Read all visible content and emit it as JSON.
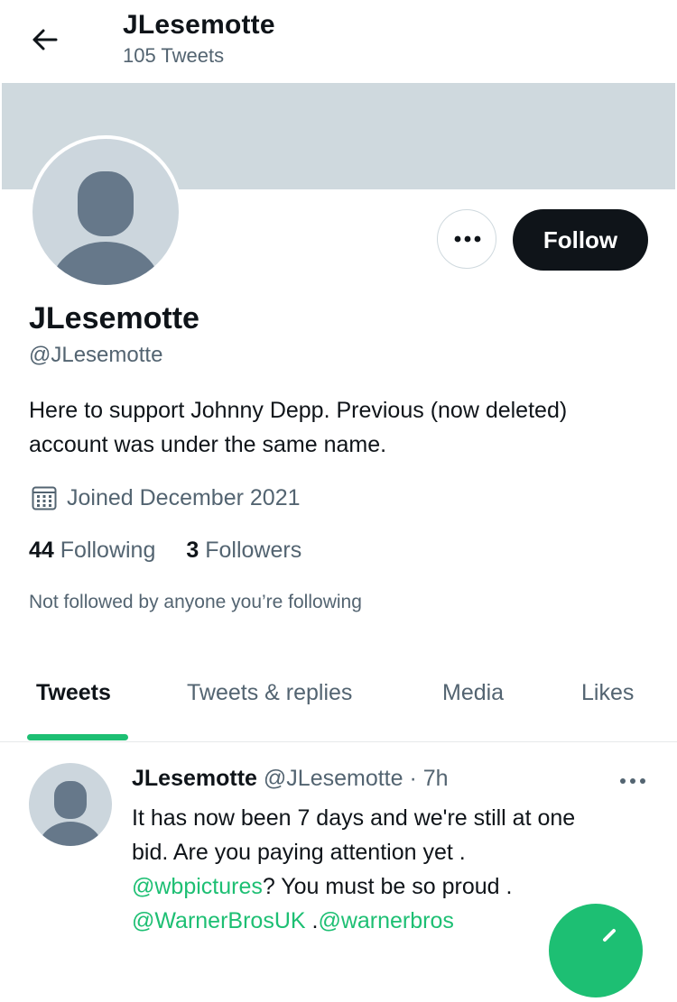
{
  "header": {
    "title": "JLesemotte",
    "subtitle": "105 Tweets",
    "back_icon": "arrow-left-icon"
  },
  "profile": {
    "name": "JLesemotte",
    "handle": "@JLesemotte",
    "bio": "Here to support Johnny Depp. Previous (now deleted) account was under the same name.",
    "joined": "Joined December 2021",
    "following_count": "44",
    "following_label": "Following",
    "followers_count": "3",
    "followers_label": "Followers",
    "not_followed": "Not followed by anyone you’re following",
    "follow_label": "Follow",
    "more_icon": "more-horizontal-icon",
    "banner_color": "#cfd9de"
  },
  "tabs": [
    {
      "label": "Tweets",
      "active": true
    },
    {
      "label": "Tweets & replies",
      "active": false
    },
    {
      "label": "Media",
      "active": false
    },
    {
      "label": "Likes",
      "active": false
    }
  ],
  "tweet": {
    "author": "JLesemotte",
    "handle": "@JLesemotte",
    "time": "· 7h",
    "line1": "It has now been 7 days and we're still at one",
    "line2": "bid. Are you paying attention yet .",
    "mention1": "@wbpictures",
    "line3_rest": "? You must be so proud .",
    "mention2": "@WarnerBrosUK",
    "sep": " .",
    "mention3": "@warnerbros"
  },
  "colors": {
    "accent": "#1dbf73",
    "text_primary": "#0f1419",
    "text_secondary": "#536471",
    "button_dark": "#0f1419"
  }
}
